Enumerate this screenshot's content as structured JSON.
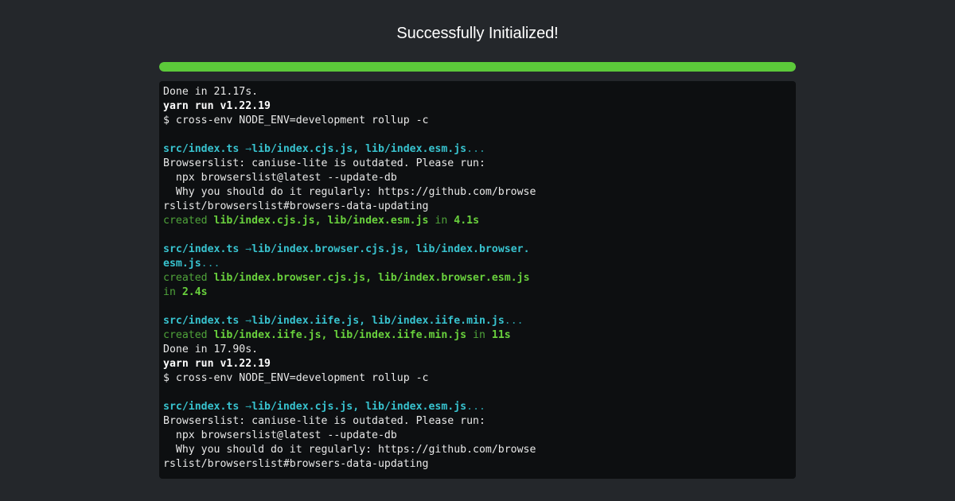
{
  "header": {
    "title": "Successfully Initialized!"
  },
  "progress": {
    "fraction": 1.0,
    "color": "#5cc93a"
  },
  "colors": {
    "background": "#24272b",
    "terminal_background": "#0d0f11",
    "cyan": "#38c3cf",
    "green": "#69d13d"
  },
  "terminal": {
    "lines": [
      [
        {
          "t": "Done in 21.17s.",
          "s": "plain"
        }
      ],
      [
        {
          "t": "yarn run v1.22.19",
          "s": "bold"
        }
      ],
      [
        {
          "t": "$ cross-env NODE_ENV=development rollup -c",
          "s": "plain"
        }
      ],
      [],
      [
        {
          "t": "src/index.ts ",
          "s": "cyan"
        },
        {
          "t": "→",
          "s": "cyan-dim"
        },
        {
          "t": "lib/index.cjs.js, lib/index.esm.js",
          "s": "cyan"
        },
        {
          "t": "...",
          "s": "cyan-dim"
        }
      ],
      [
        {
          "t": "Browserslist: caniuse-lite is outdated. Please run:",
          "s": "plain"
        }
      ],
      [
        {
          "t": "  npx browserslist@latest --update-db",
          "s": "plain"
        }
      ],
      [
        {
          "t": "  Why you should do it regularly: https://github.com/browse",
          "s": "plain"
        }
      ],
      [
        {
          "t": "rslist/browserslist#browsers-data-updating",
          "s": "plain"
        }
      ],
      [
        {
          "t": "created ",
          "s": "green-dim"
        },
        {
          "t": "lib/index.cjs.js, lib/index.esm.js",
          "s": "green-bold"
        },
        {
          "t": " in ",
          "s": "green-dim"
        },
        {
          "t": "4.1s",
          "s": "green-bold"
        }
      ],
      [],
      [
        {
          "t": "src/index.ts ",
          "s": "cyan"
        },
        {
          "t": "→",
          "s": "cyan-dim"
        },
        {
          "t": "lib/index.browser.cjs.js, lib/index.browser.",
          "s": "cyan"
        }
      ],
      [
        {
          "t": "esm.js",
          "s": "cyan"
        },
        {
          "t": "...",
          "s": "cyan-dim"
        }
      ],
      [
        {
          "t": "created ",
          "s": "green-dim"
        },
        {
          "t": "lib/index.browser.cjs.js, lib/index.browser.esm.js",
          "s": "green-bold"
        }
      ],
      [
        {
          "t": "in ",
          "s": "green-dim"
        },
        {
          "t": "2.4s",
          "s": "green-bold"
        }
      ],
      [],
      [
        {
          "t": "src/index.ts ",
          "s": "cyan"
        },
        {
          "t": "→",
          "s": "cyan-dim"
        },
        {
          "t": "lib/index.iife.js, lib/index.iife.min.js",
          "s": "cyan"
        },
        {
          "t": "...",
          "s": "cyan-dim"
        }
      ],
      [
        {
          "t": "created ",
          "s": "green-dim"
        },
        {
          "t": "lib/index.iife.js, lib/index.iife.min.js",
          "s": "green-bold"
        },
        {
          "t": " in ",
          "s": "green-dim"
        },
        {
          "t": "11s",
          "s": "green-bold"
        }
      ],
      [
        {
          "t": "Done in 17.90s.",
          "s": "plain"
        }
      ],
      [
        {
          "t": "yarn run v1.22.19",
          "s": "bold"
        }
      ],
      [
        {
          "t": "$ cross-env NODE_ENV=development rollup -c",
          "s": "plain"
        }
      ],
      [],
      [
        {
          "t": "src/index.ts ",
          "s": "cyan"
        },
        {
          "t": "→",
          "s": "cyan-dim"
        },
        {
          "t": "lib/index.cjs.js, lib/index.esm.js",
          "s": "cyan"
        },
        {
          "t": "...",
          "s": "cyan-dim"
        }
      ],
      [
        {
          "t": "Browserslist: caniuse-lite is outdated. Please run:",
          "s": "plain"
        }
      ],
      [
        {
          "t": "  npx browserslist@latest --update-db",
          "s": "plain"
        }
      ],
      [
        {
          "t": "  Why you should do it regularly: https://github.com/browse",
          "s": "plain"
        }
      ],
      [
        {
          "t": "rslist/browserslist#browsers-data-updating",
          "s": "plain"
        }
      ]
    ]
  }
}
